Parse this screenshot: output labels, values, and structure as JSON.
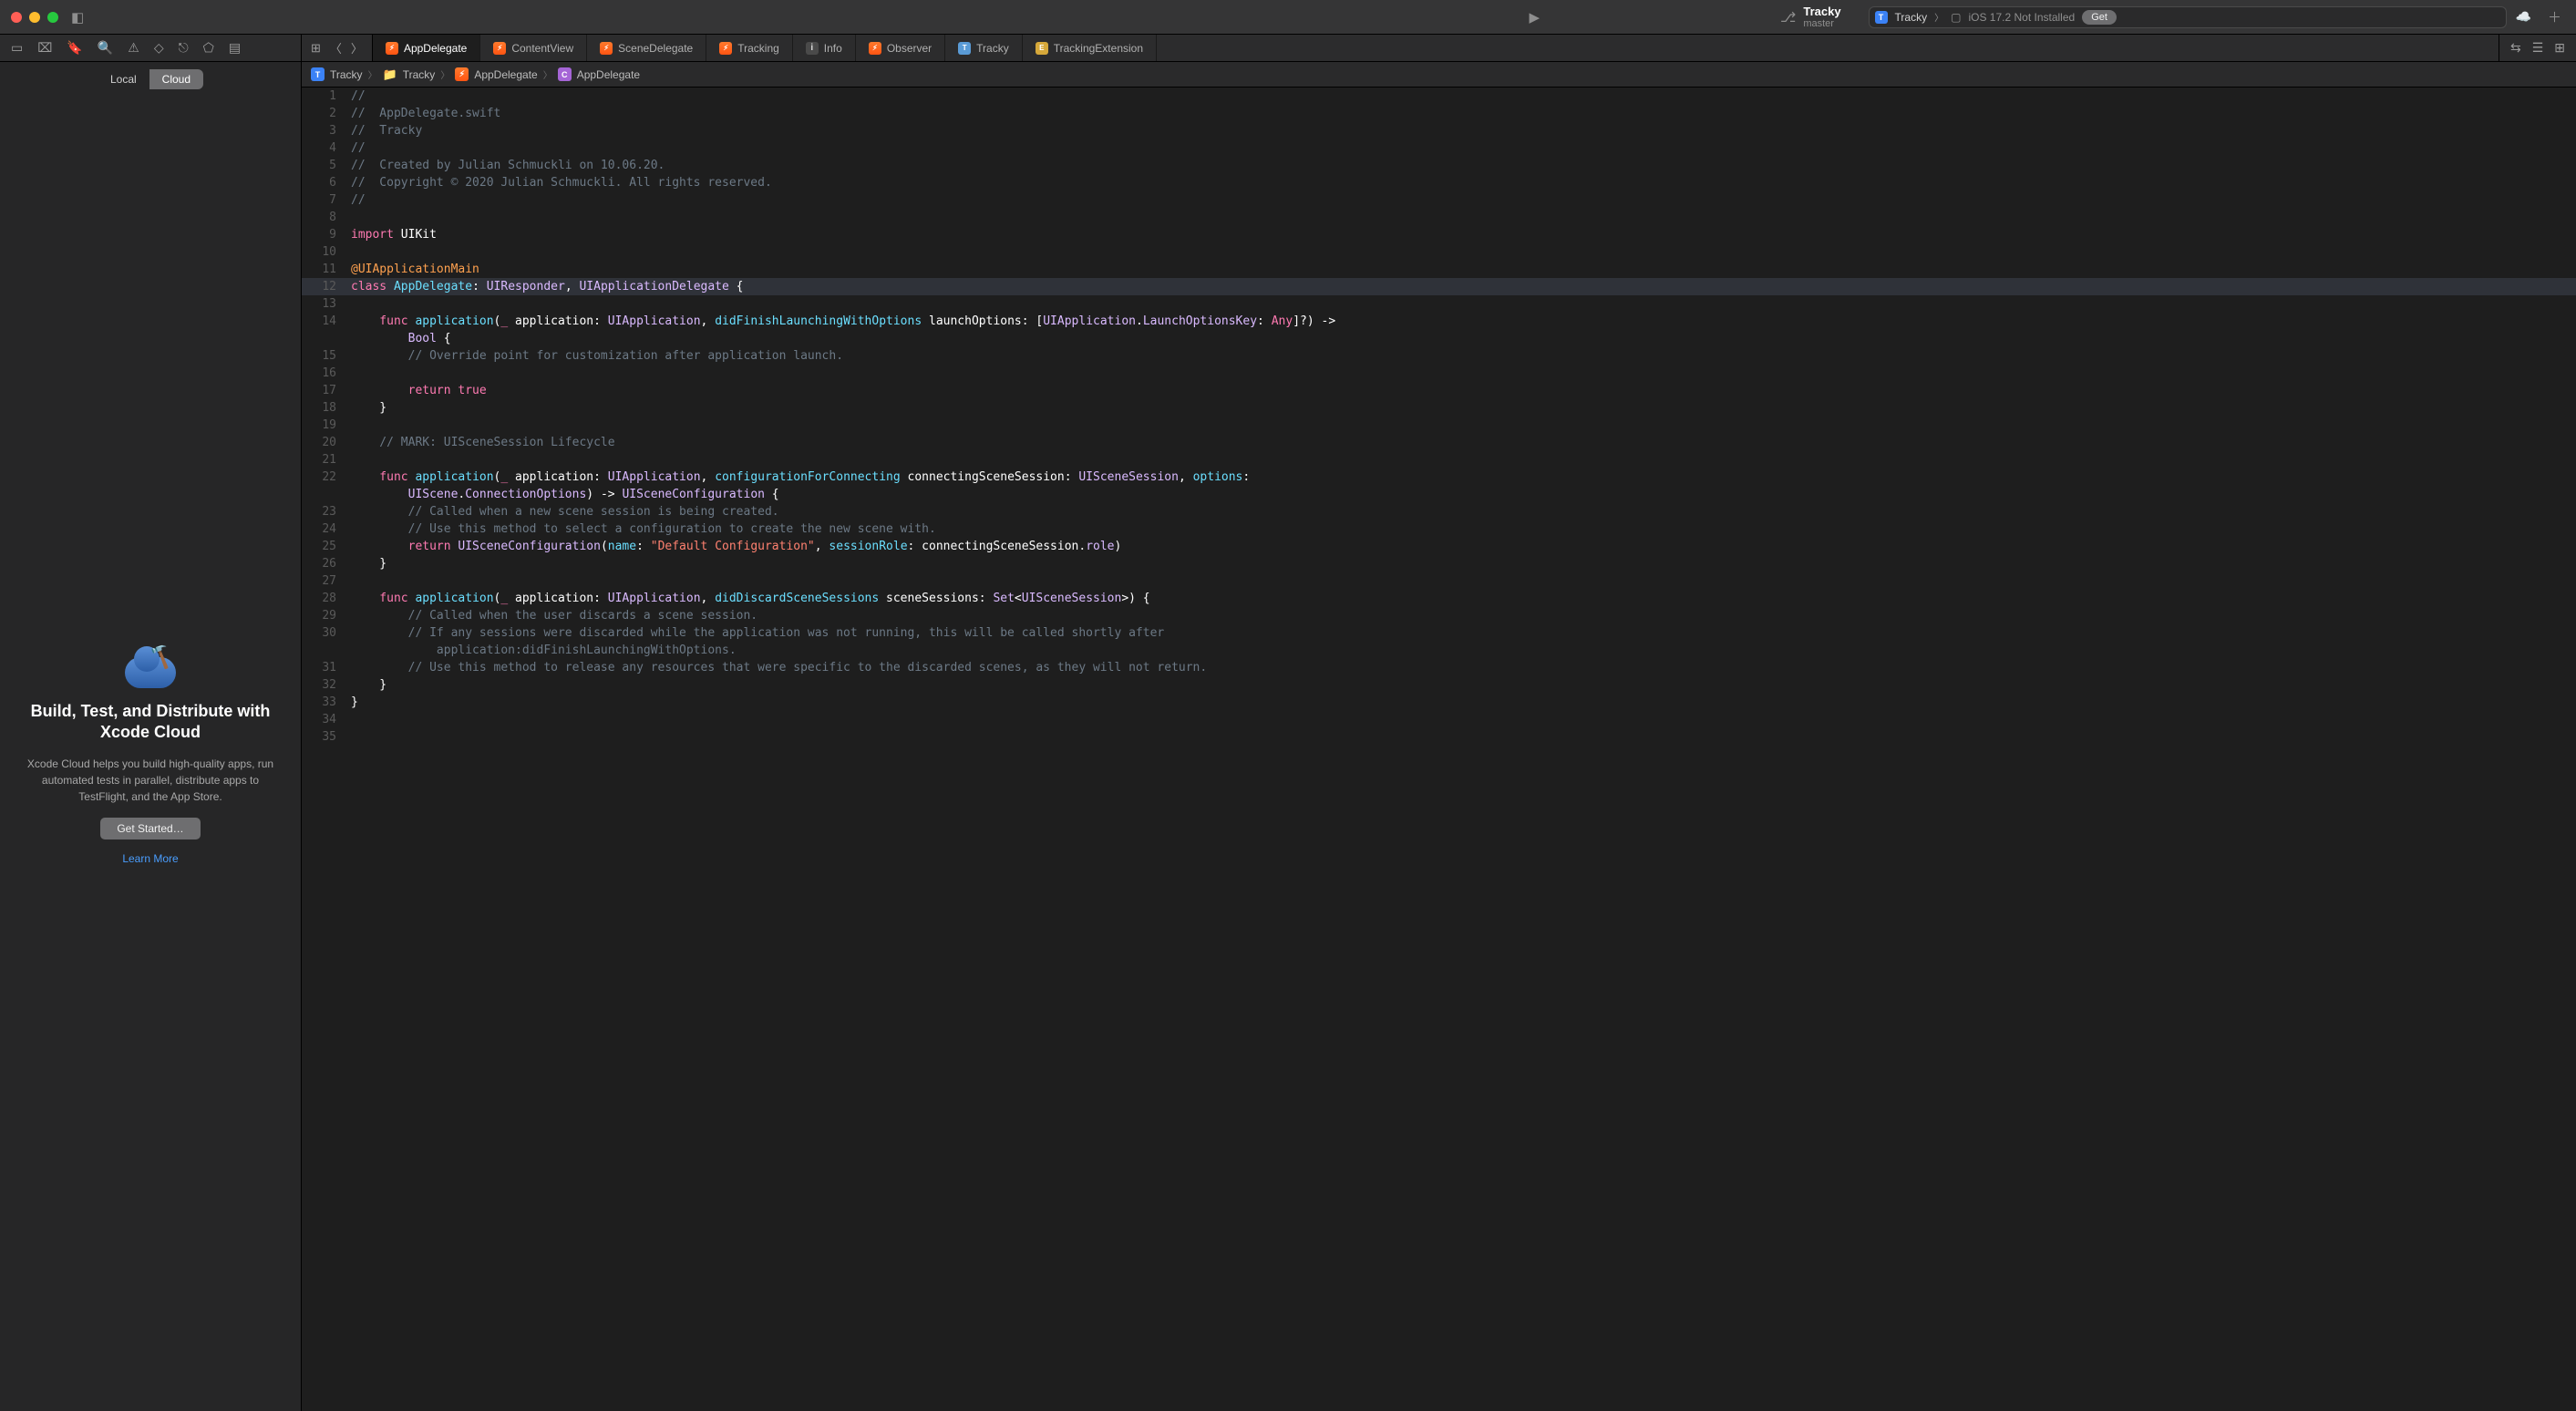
{
  "project": {
    "name": "Tracky",
    "branch": "master"
  },
  "status": {
    "scheme": "Tracky",
    "device": "iOS 17.2 Not Installed",
    "get": "Get"
  },
  "sidebar": {
    "segments": [
      "Local",
      "Cloud"
    ],
    "promo_title": "Build, Test, and Distribute with Xcode Cloud",
    "promo_body": "Xcode Cloud helps you build high-quality apps, run automated tests in parallel, distribute apps to TestFlight, and the App Store.",
    "get_started": "Get Started…",
    "learn_more": "Learn More"
  },
  "tabs": [
    {
      "label": "AppDelegate",
      "kind": "swift",
      "active": true
    },
    {
      "label": "ContentView",
      "kind": "swift"
    },
    {
      "label": "SceneDelegate",
      "kind": "swift"
    },
    {
      "label": "Tracking",
      "kind": "swift"
    },
    {
      "label": "Info",
      "kind": "info"
    },
    {
      "label": "Observer",
      "kind": "swift"
    },
    {
      "label": "Tracky",
      "kind": "app"
    },
    {
      "label": "TrackingExtension",
      "kind": "ext"
    }
  ],
  "breadcrumb": [
    {
      "label": "Tracky",
      "kind": "app"
    },
    {
      "label": "Tracky",
      "kind": "folder"
    },
    {
      "label": "AppDelegate",
      "kind": "swift"
    },
    {
      "label": "AppDelegate",
      "kind": "class"
    }
  ],
  "code": {
    "highlight": 12,
    "lines": [
      {
        "n": 1,
        "t": "//",
        "cls": "c-comment"
      },
      {
        "n": 2,
        "t": "//  AppDelegate.swift",
        "cls": "c-comment"
      },
      {
        "n": 3,
        "t": "//  Tracky",
        "cls": "c-comment"
      },
      {
        "n": 4,
        "t": "//",
        "cls": "c-comment"
      },
      {
        "n": 5,
        "t": "//  Created by Julian Schmuckli on 10.06.20.",
        "cls": "c-comment"
      },
      {
        "n": 6,
        "t": "//  Copyright © 2020 Julian Schmuckli. All rights reserved.",
        "cls": "c-comment"
      },
      {
        "n": 7,
        "t": "//",
        "cls": "c-comment"
      },
      {
        "n": 8,
        "t": "",
        "cls": ""
      },
      {
        "n": 9,
        "spans": [
          {
            "t": "import ",
            "c": "c-keyword"
          },
          {
            "t": "UIKit",
            "c": "c-plain"
          }
        ]
      },
      {
        "n": 10,
        "t": "",
        "cls": ""
      },
      {
        "n": 11,
        "spans": [
          {
            "t": "@UIApplicationMain",
            "c": "c-attr"
          }
        ]
      },
      {
        "n": 12,
        "spans": [
          {
            "t": "class ",
            "c": "c-keyword"
          },
          {
            "t": "AppDelegate",
            "c": "c-func"
          },
          {
            "t": ": ",
            "c": "c-plain"
          },
          {
            "t": "UIResponder",
            "c": "c-type"
          },
          {
            "t": ", ",
            "c": "c-plain"
          },
          {
            "t": "UIApplicationDelegate",
            "c": "c-type"
          },
          {
            "t": " {",
            "c": "c-plain"
          }
        ]
      },
      {
        "n": 13,
        "t": "",
        "cls": ""
      },
      {
        "n": 14,
        "spans": [
          {
            "t": "    func ",
            "c": "c-keyword"
          },
          {
            "t": "application",
            "c": "c-func"
          },
          {
            "t": "(",
            "c": "c-plain"
          },
          {
            "t": "_ ",
            "c": "c-keyword"
          },
          {
            "t": "application: ",
            "c": "c-plain"
          },
          {
            "t": "UIApplication",
            "c": "c-type"
          },
          {
            "t": ", ",
            "c": "c-plain"
          },
          {
            "t": "didFinishLaunchingWithOptions",
            "c": "c-param"
          },
          {
            "t": " launchOptions: [",
            "c": "c-plain"
          },
          {
            "t": "UIApplication",
            "c": "c-type"
          },
          {
            "t": ".",
            "c": "c-plain"
          },
          {
            "t": "LaunchOptionsKey",
            "c": "c-type"
          },
          {
            "t": ": ",
            "c": "c-plain"
          },
          {
            "t": "Any",
            "c": "c-keyword"
          },
          {
            "t": "]?) -> ",
            "c": "c-plain"
          }
        ]
      },
      {
        "n": "",
        "spans": [
          {
            "t": "        Bool",
            "c": "c-type"
          },
          {
            "t": " {",
            "c": "c-plain"
          }
        ]
      },
      {
        "n": 15,
        "spans": [
          {
            "t": "        // Override point for customization after application launch.",
            "c": "c-comment"
          }
        ]
      },
      {
        "n": 16,
        "t": "",
        "cls": ""
      },
      {
        "n": 17,
        "spans": [
          {
            "t": "        return ",
            "c": "c-keyword"
          },
          {
            "t": "true",
            "c": "c-true"
          }
        ]
      },
      {
        "n": 18,
        "spans": [
          {
            "t": "    }",
            "c": "c-plain"
          }
        ]
      },
      {
        "n": 19,
        "t": "",
        "cls": ""
      },
      {
        "n": 20,
        "spans": [
          {
            "t": "    // MARK: UISceneSession Lifecycle",
            "c": "c-comment"
          }
        ]
      },
      {
        "n": 21,
        "t": "",
        "cls": ""
      },
      {
        "n": 22,
        "spans": [
          {
            "t": "    func ",
            "c": "c-keyword"
          },
          {
            "t": "application",
            "c": "c-func"
          },
          {
            "t": "(",
            "c": "c-plain"
          },
          {
            "t": "_ ",
            "c": "c-keyword"
          },
          {
            "t": "application: ",
            "c": "c-plain"
          },
          {
            "t": "UIApplication",
            "c": "c-type"
          },
          {
            "t": ", ",
            "c": "c-plain"
          },
          {
            "t": "configurationForConnecting",
            "c": "c-param"
          },
          {
            "t": " connectingSceneSession: ",
            "c": "c-plain"
          },
          {
            "t": "UISceneSession",
            "c": "c-type"
          },
          {
            "t": ", ",
            "c": "c-plain"
          },
          {
            "t": "options",
            "c": "c-param"
          },
          {
            "t": ": ",
            "c": "c-plain"
          }
        ]
      },
      {
        "n": "",
        "spans": [
          {
            "t": "        UIScene",
            "c": "c-type"
          },
          {
            "t": ".",
            "c": "c-plain"
          },
          {
            "t": "ConnectionOptions",
            "c": "c-type"
          },
          {
            "t": ") -> ",
            "c": "c-plain"
          },
          {
            "t": "UISceneConfiguration",
            "c": "c-type"
          },
          {
            "t": " {",
            "c": "c-plain"
          }
        ]
      },
      {
        "n": 23,
        "spans": [
          {
            "t": "        // Called when a new scene session is being created.",
            "c": "c-comment"
          }
        ]
      },
      {
        "n": 24,
        "spans": [
          {
            "t": "        // Use this method to select a configuration to create the new scene with.",
            "c": "c-comment"
          }
        ]
      },
      {
        "n": 25,
        "spans": [
          {
            "t": "        return ",
            "c": "c-keyword"
          },
          {
            "t": "UISceneConfiguration",
            "c": "c-type"
          },
          {
            "t": "(",
            "c": "c-plain"
          },
          {
            "t": "name",
            "c": "c-param"
          },
          {
            "t": ": ",
            "c": "c-plain"
          },
          {
            "t": "\"Default Configuration\"",
            "c": "c-string"
          },
          {
            "t": ", ",
            "c": "c-plain"
          },
          {
            "t": "sessionRole",
            "c": "c-param"
          },
          {
            "t": ": connectingSceneSession.",
            "c": "c-plain"
          },
          {
            "t": "role",
            "c": "c-purple"
          },
          {
            "t": ")",
            "c": "c-plain"
          }
        ]
      },
      {
        "n": 26,
        "spans": [
          {
            "t": "    }",
            "c": "c-plain"
          }
        ]
      },
      {
        "n": 27,
        "t": "",
        "cls": ""
      },
      {
        "n": 28,
        "spans": [
          {
            "t": "    func ",
            "c": "c-keyword"
          },
          {
            "t": "application",
            "c": "c-func"
          },
          {
            "t": "(",
            "c": "c-plain"
          },
          {
            "t": "_ ",
            "c": "c-keyword"
          },
          {
            "t": "application: ",
            "c": "c-plain"
          },
          {
            "t": "UIApplication",
            "c": "c-type"
          },
          {
            "t": ", ",
            "c": "c-plain"
          },
          {
            "t": "didDiscardSceneSessions",
            "c": "c-param"
          },
          {
            "t": " sceneSessions: ",
            "c": "c-plain"
          },
          {
            "t": "Set",
            "c": "c-type"
          },
          {
            "t": "<",
            "c": "c-plain"
          },
          {
            "t": "UISceneSession",
            "c": "c-type"
          },
          {
            "t": ">) {",
            "c": "c-plain"
          }
        ]
      },
      {
        "n": 29,
        "spans": [
          {
            "t": "        // Called when the user discards a scene session.",
            "c": "c-comment"
          }
        ]
      },
      {
        "n": 30,
        "spans": [
          {
            "t": "        // If any sessions were discarded while the application was not running, this will be called shortly after ",
            "c": "c-comment"
          }
        ]
      },
      {
        "n": "",
        "spans": [
          {
            "t": "            application:didFinishLaunchingWithOptions.",
            "c": "c-comment"
          }
        ]
      },
      {
        "n": 31,
        "spans": [
          {
            "t": "        // Use this method to release any resources that were specific to the discarded scenes, as they will not return.",
            "c": "c-comment"
          }
        ]
      },
      {
        "n": 32,
        "spans": [
          {
            "t": "    }",
            "c": "c-plain"
          }
        ]
      },
      {
        "n": 33,
        "spans": [
          {
            "t": "}",
            "c": "c-plain"
          }
        ]
      },
      {
        "n": 34,
        "t": "",
        "cls": ""
      },
      {
        "n": 35,
        "t": "",
        "cls": ""
      }
    ]
  }
}
